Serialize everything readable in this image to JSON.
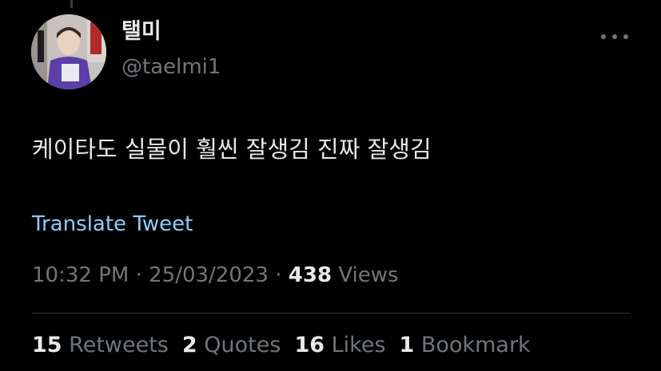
{
  "author": {
    "display_name": "탤미",
    "handle": "@taelmi1"
  },
  "more_menu": {
    "icon": "more-horizontal-icon"
  },
  "tweet": {
    "text": "케이타도 실물이 훨씬 잘생김 진짜 잘생김",
    "translate_label": "Translate Tweet",
    "time": "10:32 PM",
    "date": "25/03/2023",
    "separator": " · ",
    "views_count": "438",
    "views_label": "Views"
  },
  "stats": [
    {
      "count": "15",
      "label": "Retweets"
    },
    {
      "count": "2",
      "label": "Quotes"
    },
    {
      "count": "16",
      "label": "Likes"
    },
    {
      "count": "1",
      "label": "Bookmark"
    }
  ],
  "colors": {
    "background": "#000000",
    "primary_text": "#e7e9ea",
    "secondary_text": "#71767b",
    "link": "#8ecdf8",
    "divider": "#2f3336"
  }
}
